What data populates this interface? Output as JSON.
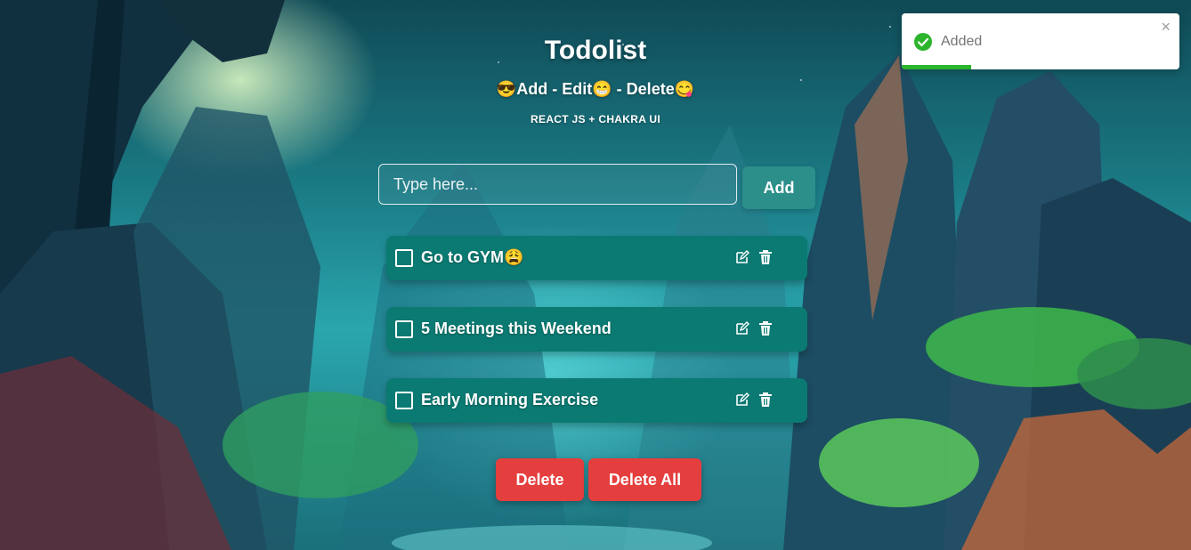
{
  "header": {
    "title": "Todolist",
    "subtitle": "😎Add - Edit😁 - Delete😋",
    "tagline": "REACT JS + CHAKRA UI"
  },
  "form": {
    "input_placeholder": "Type here...",
    "input_value": "",
    "add_label": "Add"
  },
  "todos": [
    {
      "text": "Go to GYM😩",
      "checked": false
    },
    {
      "text": "5 Meetings this Weekend",
      "checked": false
    },
    {
      "text": "Early Morning Exercise",
      "checked": false
    }
  ],
  "actions": {
    "delete_label": "Delete",
    "delete_all_label": "Delete All"
  },
  "toast": {
    "message": "Added",
    "close_glyph": "×",
    "progress": 0.25
  },
  "colors": {
    "todo_bg": "#0a7a72",
    "add_button": "#2c8f8a",
    "danger": "#e53e3e",
    "success": "#2cb52c"
  }
}
